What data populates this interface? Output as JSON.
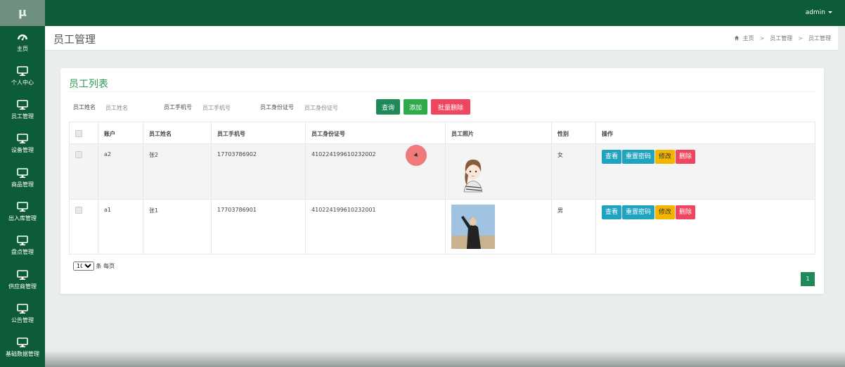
{
  "app": {
    "logo_text": "μ",
    "user": "admin"
  },
  "sidebar": {
    "items": [
      {
        "label": "主页",
        "icon": "dashboard-icon"
      },
      {
        "label": "个人中心",
        "icon": "monitor-icon"
      },
      {
        "label": "员工管理",
        "icon": "monitor-icon"
      },
      {
        "label": "设备管理",
        "icon": "monitor-icon"
      },
      {
        "label": "商品管理",
        "icon": "monitor-icon"
      },
      {
        "label": "出入库管理",
        "icon": "monitor-icon"
      },
      {
        "label": "盘点管理",
        "icon": "monitor-icon"
      },
      {
        "label": "供应商管理",
        "icon": "monitor-icon"
      },
      {
        "label": "公告管理",
        "icon": "monitor-icon"
      },
      {
        "label": "基础数据管理",
        "icon": "monitor-icon"
      }
    ]
  },
  "header": {
    "title": "员工管理",
    "breadcrumb": [
      "主页",
      "员工管理",
      "员工管理"
    ],
    "breadcrumb_icon": "home-icon"
  },
  "card": {
    "title": "员工列表",
    "filters": {
      "name_label": "员工姓名",
      "name_placeholder": "员工姓名",
      "phone_label": "员工手机号",
      "phone_placeholder": "员工手机号",
      "idcard_label": "员工身份证号",
      "idcard_placeholder": "员工身份证号"
    },
    "buttons": {
      "query": "查询",
      "add": "添加",
      "batch_delete": "批量删除"
    },
    "table": {
      "columns": [
        "账户",
        "员工姓名",
        "员工手机号",
        "员工身份证号",
        "员工照片",
        "性别",
        "操作"
      ],
      "rows": [
        {
          "account": "a2",
          "name": "张2",
          "phone": "17703786902",
          "idcard": "410224199610232002",
          "photo": "cartoon-girl-photo",
          "gender": "女"
        },
        {
          "account": "a1",
          "name": "张1",
          "phone": "17703786901",
          "idcard": "410224199610232001",
          "photo": "person-photo",
          "gender": "男"
        }
      ],
      "actions": {
        "view": "查看",
        "reset": "重置密码",
        "edit": "修改",
        "delete": "删除"
      }
    },
    "pager": {
      "page_size": "10",
      "per_page_label": "条 每页",
      "current_page": "1"
    }
  },
  "colors": {
    "primary": "#0d5c38",
    "title_green": "#2e9a55",
    "info": "#1fa3bf",
    "warning": "#f2b600",
    "danger": "#f0455e",
    "success": "#2faa4a"
  }
}
